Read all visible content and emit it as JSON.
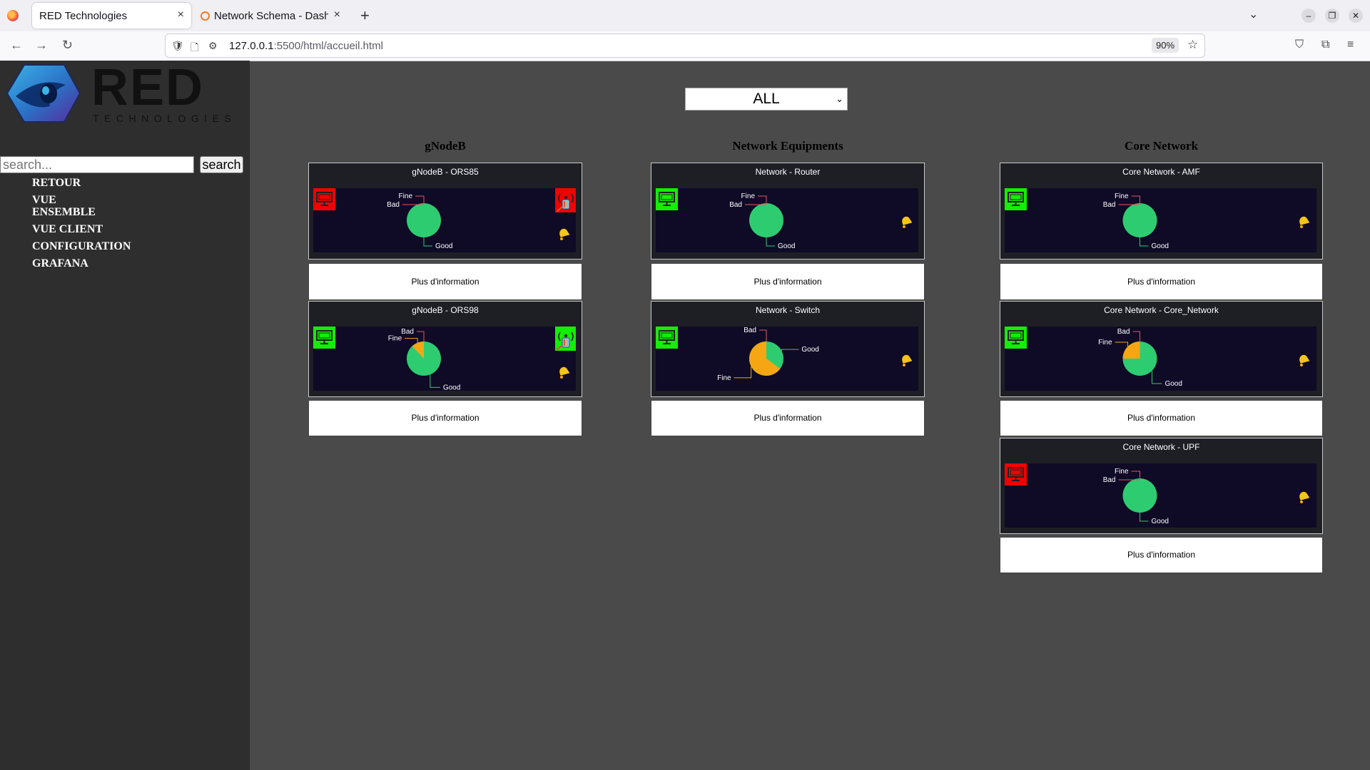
{
  "browser": {
    "tabs": [
      {
        "label": "RED Technologies",
        "close": "×"
      },
      {
        "label": "Network Schema - Dashb",
        "close": "×"
      }
    ],
    "new_tab": "+",
    "url_host": "127.0.0.1",
    "url_path": ":5500/html/accueil.html",
    "zoom": "90%"
  },
  "sidebar": {
    "search_placeholder": "search...",
    "search_button": "search",
    "menu": [
      "RETOUR",
      "VUE ENSEMBLE",
      "VUE CLIENT",
      "CONFIGURATION",
      "GRAFANA"
    ]
  },
  "filter": {
    "selected": "ALL"
  },
  "columns": [
    {
      "title": "gNodeB"
    },
    {
      "title": "Network Equipments"
    },
    {
      "title": "Core Network"
    }
  ],
  "pie_labels": {
    "good": "Good",
    "fine": "Fine",
    "bad": "Bad"
  },
  "colors": {
    "good": "#2ecc71",
    "fine": "#f5a612",
    "bad": "#e74c3c",
    "alert_red": "#f20000",
    "alert_green": "#12ef00"
  },
  "more_info": "Plus d'information",
  "cards": [
    {
      "title": "gNodeB - ORS85",
      "pc_status": "red",
      "antenna_status": "red",
      "pie": {
        "good": 100,
        "fine": 0,
        "bad": 0
      }
    },
    {
      "title": "gNodeB - ORS98",
      "pc_status": "green",
      "antenna_status": "green",
      "pie": {
        "good": 88,
        "fine": 12,
        "bad": 0
      }
    },
    {
      "title": "Network - Router",
      "pc_status": "green",
      "pie": {
        "good": 100,
        "fine": 0,
        "bad": 0
      }
    },
    {
      "title": "Network - Switch",
      "pc_status": "green",
      "pie": {
        "good": 35,
        "fine": 65,
        "bad": 0
      }
    },
    {
      "title": "Core Network - AMF",
      "pc_status": "green",
      "pie": {
        "good": 100,
        "fine": 0,
        "bad": 0
      }
    },
    {
      "title": "Core Network - Core_Network",
      "pc_status": "green",
      "pie": {
        "good": 75,
        "fine": 25,
        "bad": 0
      }
    },
    {
      "title": "Core Network - UPF",
      "pc_status": "red",
      "pie": {
        "good": 100,
        "fine": 0,
        "bad": 0
      }
    }
  ]
}
